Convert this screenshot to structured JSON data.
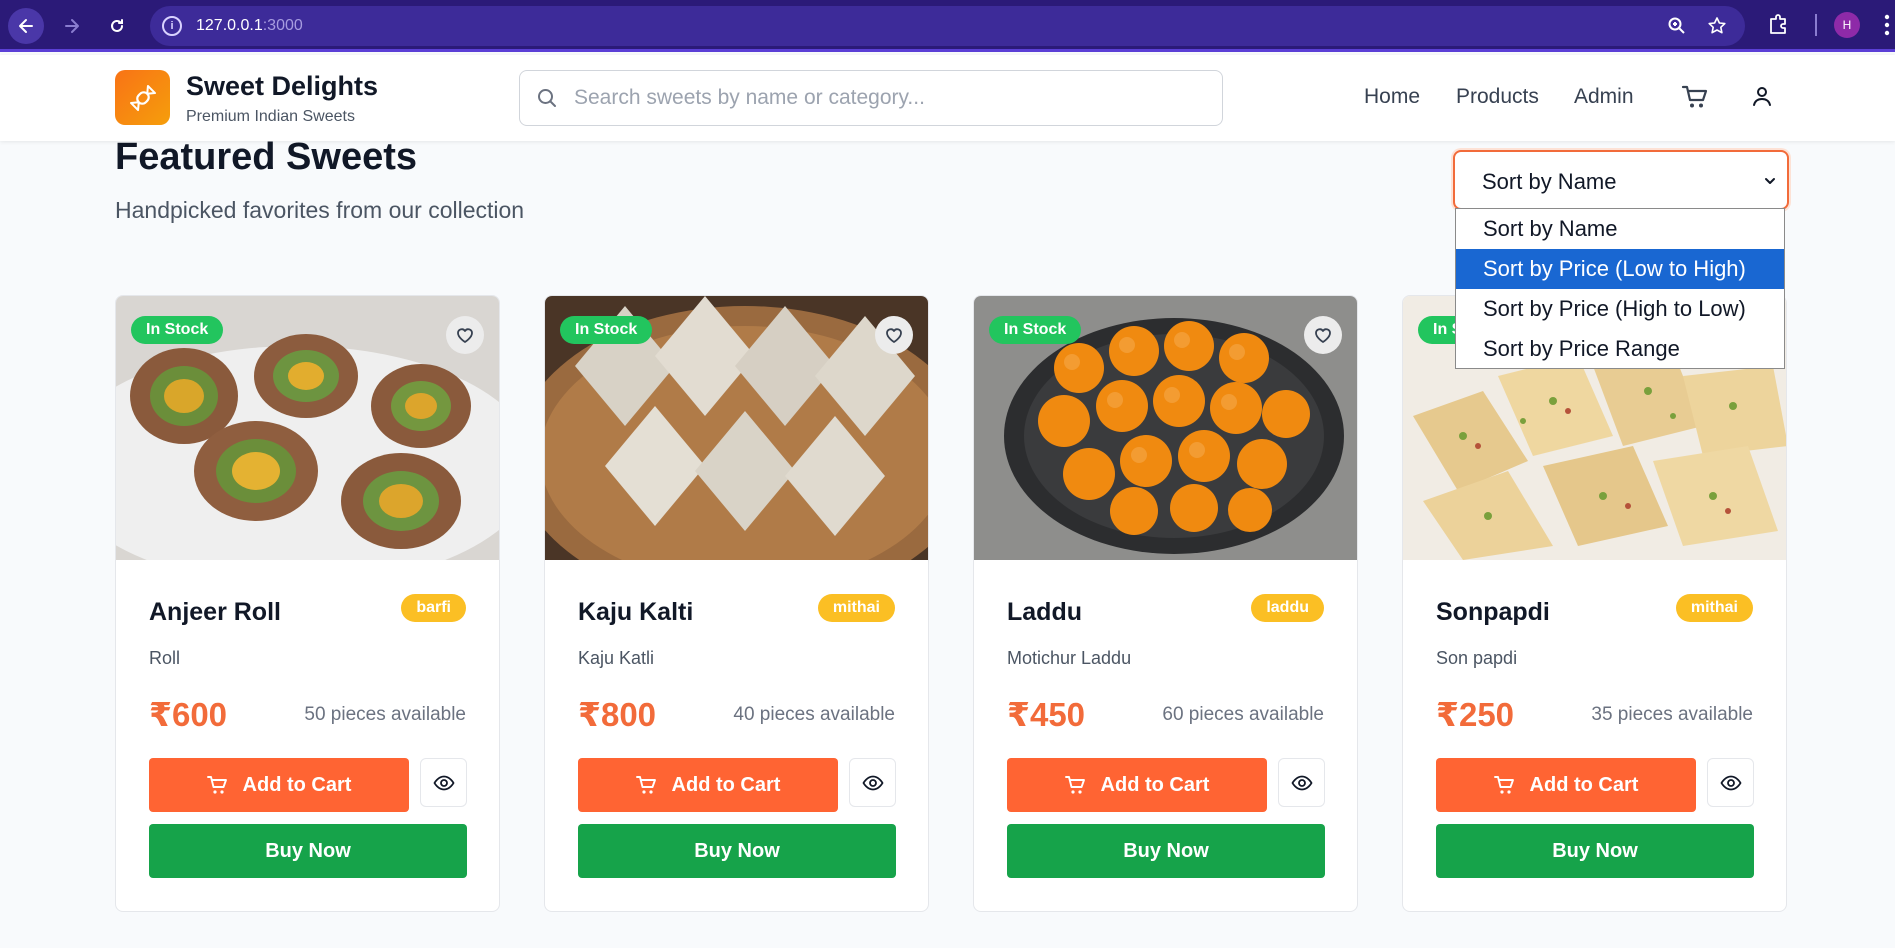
{
  "browser": {
    "url_host": "127.0.0.1",
    "url_port": ":3000",
    "profile_initial": "H"
  },
  "header": {
    "brand_title": "Sweet Delights",
    "brand_subtitle": "Premium Indian Sweets",
    "search_placeholder": "Search sweets by name or category...",
    "nav": {
      "home": "Home",
      "products": "Products",
      "admin": "Admin"
    }
  },
  "section": {
    "title": "Featured Sweets",
    "subtitle": "Handpicked favorites from our collection"
  },
  "sort": {
    "selected": "Sort by Name",
    "options": [
      "Sort by Name",
      "Sort by Price (Low to High)",
      "Sort by Price (High to Low)",
      "Sort by Price Range"
    ],
    "highlighted_index": 1
  },
  "colors": {
    "accent_orange": "#ff6433",
    "stock_green": "#22c55e",
    "buy_green": "#16a34a",
    "category_amber": "#fbbf24",
    "browser_purple": "#2b1a78"
  },
  "products": [
    {
      "stock": "In Stock",
      "name": "Anjeer Roll",
      "category": "barfi",
      "description": "Roll",
      "price": "₹600",
      "availability": "50 pieces available",
      "add_to_cart": "Add to Cart",
      "buy_now": "Buy Now"
    },
    {
      "stock": "In Stock",
      "name": "Kaju Kalti",
      "category": "mithai",
      "description": "Kaju Katli",
      "price": "₹800",
      "availability": "40 pieces available",
      "add_to_cart": "Add to Cart",
      "buy_now": "Buy Now"
    },
    {
      "stock": "In Stock",
      "name": "Laddu",
      "category": "laddu",
      "description": "Motichur Laddu",
      "price": "₹450",
      "availability": "60 pieces available",
      "add_to_cart": "Add to Cart",
      "buy_now": "Buy Now"
    },
    {
      "stock": "In Stock",
      "name": "Sonpapdi",
      "category": "mithai",
      "description": "Son papdi",
      "price": "₹250",
      "availability": "35 pieces available",
      "add_to_cart": "Add to Cart",
      "buy_now": "Buy Now"
    }
  ]
}
